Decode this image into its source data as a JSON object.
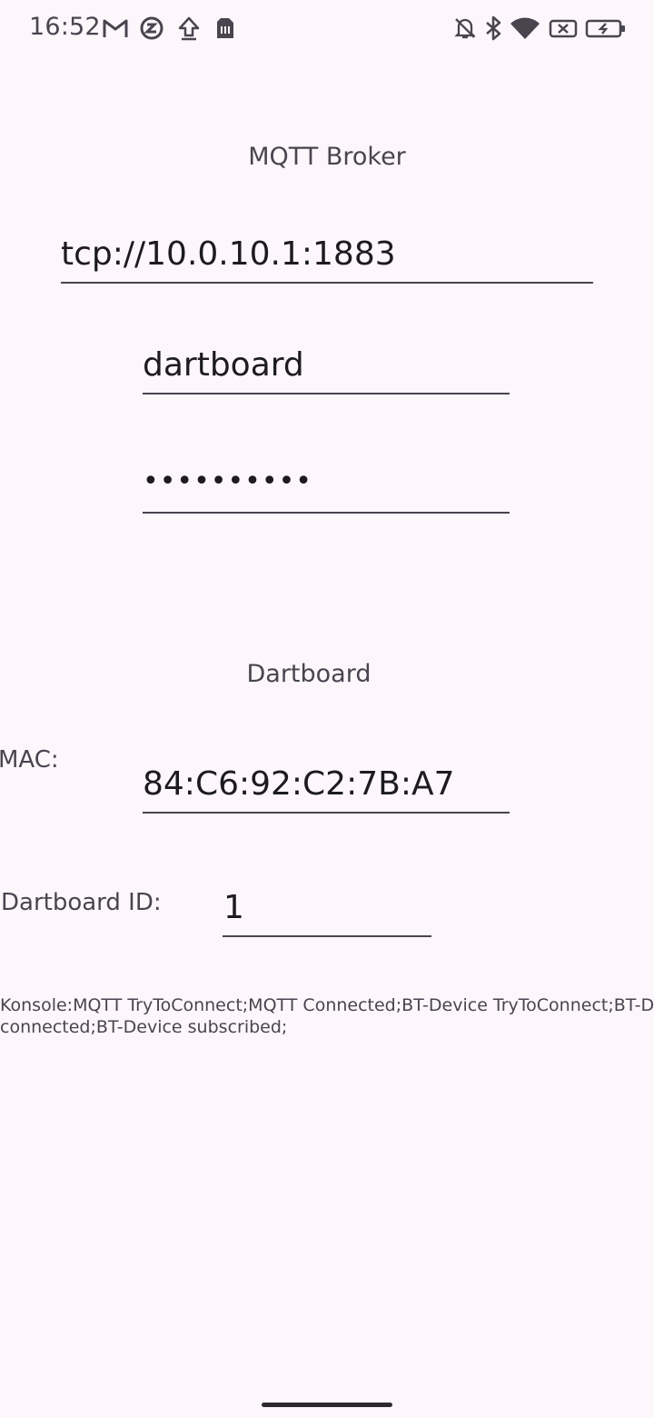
{
  "status_bar": {
    "time": "16:52",
    "left_icons": [
      "gmail-icon",
      "vpn-icon",
      "upload-icon",
      "sim-card-icon"
    ],
    "right_icons": [
      "bell-off-icon",
      "bluetooth-icon",
      "wifi-icon",
      "no-sim-icon",
      "battery-charging-icon"
    ]
  },
  "mqtt": {
    "title": "MQTT Broker",
    "url": "tcp://10.0.10.1:1883",
    "username": "dartboard",
    "password_mask": "••••••••••"
  },
  "dartboard": {
    "title": "Dartboard",
    "mac_label": "MAC:",
    "mac_value": "84:C6:92:C2:7B:A7",
    "id_label": "Dartboard ID:",
    "id_value": "1"
  },
  "console": {
    "line1": "Konsole:MQTT TryToConnect;MQTT Connected;BT-Device TryToConnect;BT-Device",
    "line2": "connected;BT-Device subscribed;"
  }
}
